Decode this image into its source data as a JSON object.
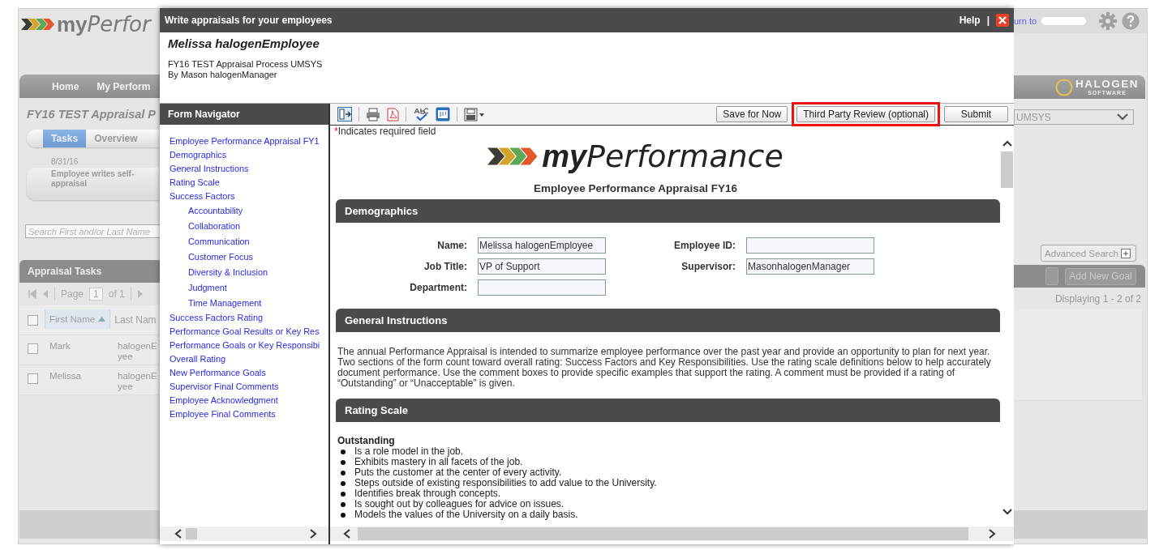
{
  "background_app": {
    "logo": {
      "bold": "my",
      "light": "Perfor"
    },
    "header_link": "urn to",
    "nav": [
      {
        "label": "Home"
      },
      {
        "label": "My Perform"
      }
    ],
    "brand": {
      "name": "HALOGEN",
      "tagline": "SOFTWARE"
    },
    "process_title": "FY16 TEST Appraisal P",
    "process_select": "UMSYS",
    "tabs": [
      {
        "label": "Tasks",
        "selected": true
      },
      {
        "label": "Overview",
        "selected": false
      }
    ],
    "step": {
      "date": "8/31/16",
      "label": "Employee writes self-appraisal"
    },
    "search": {
      "placeholder": "Search First and/or Last Name"
    },
    "advanced_search": "Advanced Search",
    "tasks_panel": {
      "title": "Appraisal Tasks",
      "add_button": {
        "label": "Add New Goal",
        "disabled": true
      },
      "pager": {
        "label": "Page",
        "page": "1",
        "of": "of 1"
      },
      "displaying": "Displaying 1 - 2 of 2",
      "select_all_checked": false,
      "columns": [
        "First Name",
        "Last Nam"
      ],
      "rows": [
        {
          "first_name": "Mark",
          "last_name": "halogenE yee",
          "checked": false
        },
        {
          "first_name": "Melissa",
          "last_name": "halogenE yee",
          "checked": false
        }
      ]
    }
  },
  "dialog": {
    "title": "Write appraisals for your employees",
    "help": "Help",
    "separator": "|",
    "employee": "Melissa halogenEmployee",
    "process": "FY16 TEST Appraisal Process UMSYS",
    "manager": "By Mason halogenManager",
    "navigator": {
      "title": "Form Navigator",
      "items": [
        {
          "label": "Employee Performance Appraisal FY1"
        },
        {
          "label": "Demographics"
        },
        {
          "label": "General Instructions"
        },
        {
          "label": "Rating Scale"
        },
        {
          "label": "Success Factors",
          "children": [
            {
              "label": "Accountability"
            },
            {
              "label": "Collaboration"
            },
            {
              "label": "Communication"
            },
            {
              "label": "Customer Focus"
            },
            {
              "label": "Diversity & Inclusion"
            },
            {
              "label": "Judgment"
            },
            {
              "label": "Time Management"
            }
          ]
        },
        {
          "label": "Success Factors Rating"
        },
        {
          "label": "Performance Goal Results or Key Res"
        },
        {
          "label": "Performance Goals or Key Responsibi"
        },
        {
          "label": "Overall Rating"
        },
        {
          "label": "New Performance Goals"
        },
        {
          "label": "Supervisor Final Comments"
        },
        {
          "label": "Employee Acknowledgment"
        },
        {
          "label": "Employee Final Comments"
        }
      ]
    },
    "toolbar": {
      "buttons": [
        {
          "label": "Save for Now",
          "highlighted": false
        },
        {
          "label": "Third Party Review (optional)",
          "highlighted": true
        },
        {
          "label": "Submit",
          "highlighted": false
        }
      ]
    },
    "form": {
      "required_note": {
        "mark": "*",
        "text": "Indicates required field"
      },
      "logo": {
        "bold": "my",
        "light": "Performance"
      },
      "title": "Employee Performance Appraisal FY16",
      "sections": [
        {
          "kind": "fields",
          "title": "Demographics",
          "fields": [
            {
              "label": "Name:",
              "value": "Melissa halogenEmployee"
            },
            {
              "label": "Employee ID:"
            },
            {
              "label": "Job Title:",
              "value": "VP of Support"
            },
            {
              "label": "Supervisor:",
              "value": "MasonhalogenManager"
            },
            {
              "label": "Department:"
            }
          ]
        },
        {
          "kind": "text",
          "title": "General Instructions",
          "text": "The annual Performance Appraisal is intended to summarize employee performance over the past year and provide an opportunity to plan for next year. Two sections of the form count toward overall rating: Success Factors and Key Responsibilities. Use the rating scale definitions below to help accurately document performance. Use the comment boxes to provide specific examples that support the rating. A comment must be provided if a rating of “Outstanding” or “Unacceptable” is given."
        },
        {
          "kind": "list",
          "title": "Rating Scale",
          "heading": "Outstanding",
          "items": [
            "Is a role model in the job.",
            "Exhibits mastery in all facets of the job.",
            "Puts the customer at the center of every activity.",
            "Steps outside of existing responsibilities to add value to the University.",
            "Identifies break through concepts.",
            "Is sought out by colleagues for advice on issues.",
            "Models the values of the University on a daily basis."
          ]
        }
      ]
    }
  }
}
